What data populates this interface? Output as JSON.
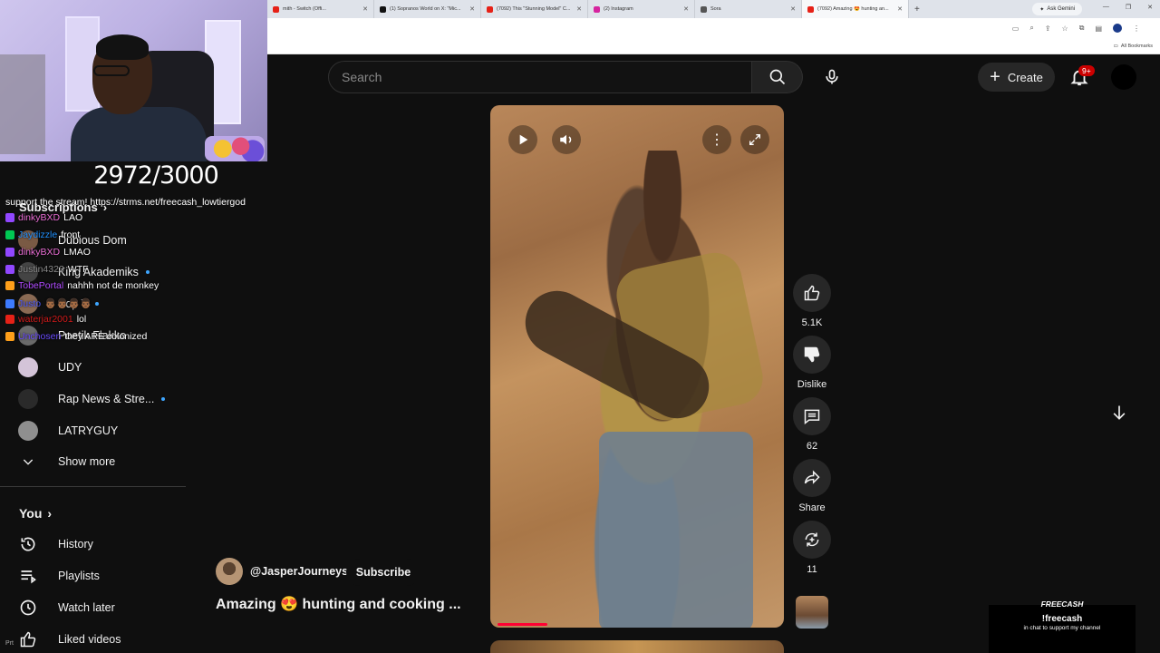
{
  "browser": {
    "tabs": [
      {
        "title": "mith - Switch (Offi...",
        "color": "#e62117"
      },
      {
        "title": "(1) Sopranos World on X: \"Mic...",
        "color": "#111111"
      },
      {
        "title": "(7092) This \"Stunning Model\" C...",
        "color": "#e62117"
      },
      {
        "title": "(2) Instagram",
        "color": "#d6249f"
      },
      {
        "title": "Sora",
        "color": "#555555"
      },
      {
        "title": "(7092) Amazing 😍 hunting an...",
        "color": "#e62117"
      }
    ],
    "new_tab": "+",
    "ask_gemini": "Ask Gemini",
    "bookmarks_label": "All Bookmarks"
  },
  "stream": {
    "sub_counter": "2972/3000",
    "support_message": "support the stream! https://strms.net/freecash_lowtiergod"
  },
  "chat": [
    {
      "user": "dinkyBXD",
      "text": "LAO",
      "user_color": "#e96dd4",
      "badge": "#9147ff"
    },
    {
      "user": "Jaydizzle",
      "text": "front",
      "user_color": "#1e90ff",
      "badge": "#00c853"
    },
    {
      "user": "dinkyBXD",
      "text": "LMAO",
      "user_color": "#e96dd4",
      "badge": "#9147ff"
    },
    {
      "user": "Justin4323",
      "text": "WTF",
      "user_color": "#8a8a8a",
      "badge": "#9147ff"
    },
    {
      "user": "TobePortal",
      "text": "nahhh not de monkey",
      "user_color": "#b04bff",
      "badge": "#ff9f1a"
    },
    {
      "user": "Justo",
      "text": "👨🏾👨🏾👨🏾👨🏾",
      "user_color": "#4b5bff",
      "badge": "#3d7bff"
    },
    {
      "user": "waterjar2001",
      "text": "lol",
      "user_color": "#d11a1a",
      "badge": "#e62117"
    },
    {
      "user": "Unchosen",
      "text": "they ARE colonized",
      "user_color": "#6a4bff",
      "badge": "#ff9f1a"
    }
  ],
  "sidebar": {
    "subscriptions_heading": "Subscriptions",
    "subscriptions": [
      {
        "name": "Dubious Dom",
        "avatar": "#7a5a44",
        "live": false
      },
      {
        "name": "King Akademiks",
        "avatar": "#444444",
        "live": true
      },
      {
        "name": "Pop T",
        "avatar": "#8a6a54",
        "live": true
      },
      {
        "name": "Poetik Flakko",
        "avatar": "#6a6a6a",
        "live": false
      },
      {
        "name": "UDY",
        "avatar": "#d4c4d8",
        "live": false
      },
      {
        "name": "Rap News & Stre...",
        "avatar": "#2a2a2a",
        "live": true
      },
      {
        "name": "LATRYGUY",
        "avatar": "#8f8f8f",
        "live": false
      }
    ],
    "show_more": "Show more",
    "you_heading": "You",
    "you_items": [
      {
        "name": "History",
        "icon": "history-icon"
      },
      {
        "name": "Playlists",
        "icon": "playlists-icon"
      },
      {
        "name": "Watch later",
        "icon": "watch-later-icon"
      },
      {
        "name": "Liked videos",
        "icon": "like-icon"
      }
    ]
  },
  "masthead": {
    "search_placeholder": "Search",
    "create_label": "Create",
    "notification_count": "9+"
  },
  "short": {
    "channel": "@JasperJourneys",
    "subscribe_label": "Subscribe",
    "title": "Amazing 😍 hunting and cooking ...",
    "likes": "5.1K",
    "dislike_label": "Dislike",
    "comments": "62",
    "share_label": "Share",
    "remix_count": "11",
    "progress": 0.17
  },
  "freecash": {
    "logo": "FREECASH",
    "command": "!freecash",
    "text": "in chat to support my channel"
  },
  "bottom_badge": "Рrt"
}
